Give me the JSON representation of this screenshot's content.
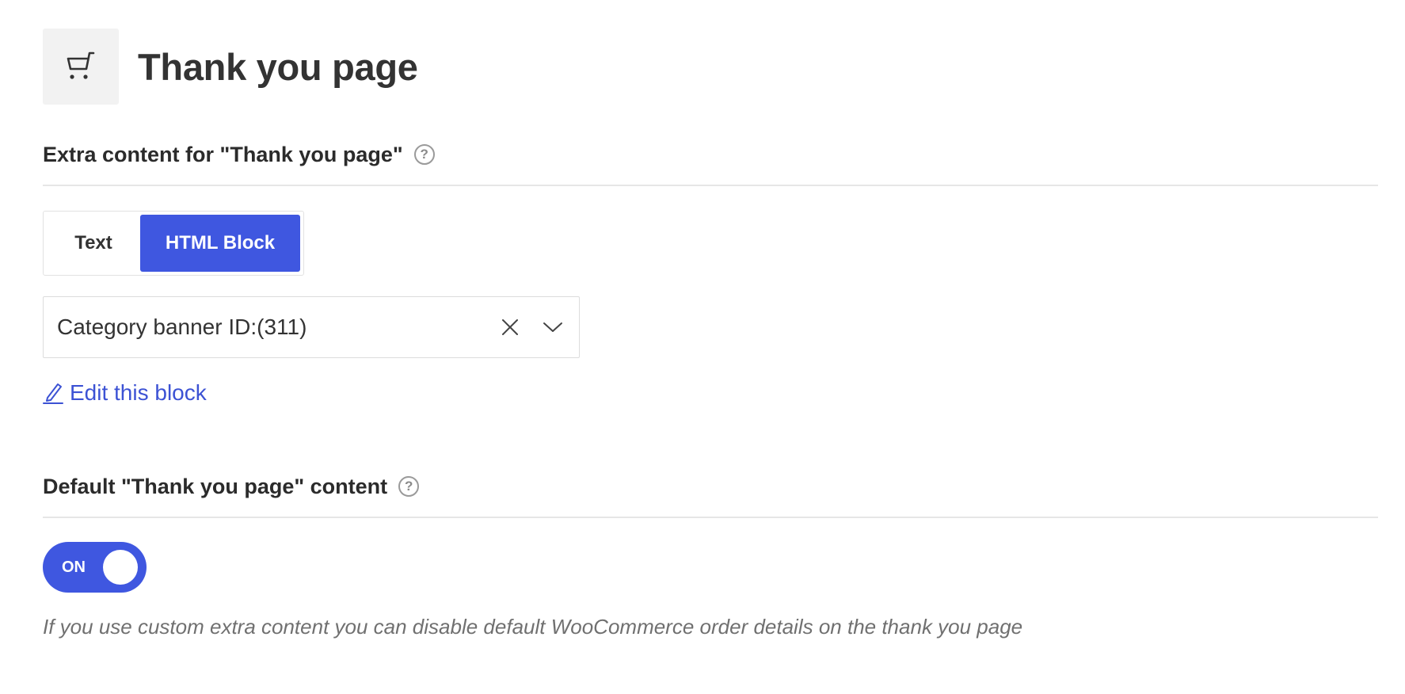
{
  "header": {
    "title": "Thank you page",
    "icon": "cart-icon"
  },
  "extra_content": {
    "heading": "Extra content for \"Thank you page\"",
    "help_symbol": "?",
    "content_type": {
      "options": [
        "Text",
        "HTML Block"
      ],
      "selected": "HTML Block"
    },
    "block_select": {
      "value": "Category banner ID:(311)"
    },
    "edit_link": "Edit this block"
  },
  "default_content": {
    "heading": "Default \"Thank you page\" content",
    "help_symbol": "?",
    "toggle": {
      "label": "ON",
      "state": true
    },
    "description": "If you use custom extra content you can disable default WooCommerce order details on the thank you page"
  },
  "colors": {
    "accent": "#3f57e0",
    "link": "#3c52d4"
  }
}
